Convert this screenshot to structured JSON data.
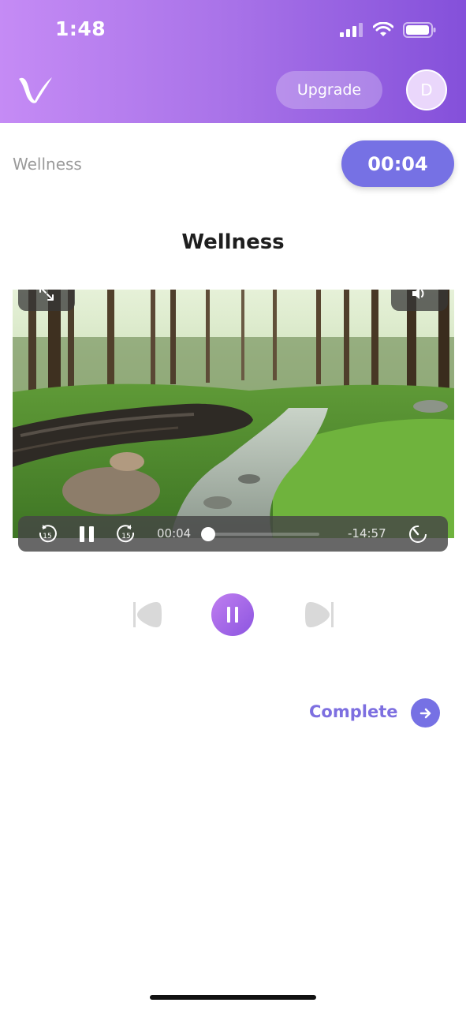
{
  "status_bar": {
    "time": "1:48"
  },
  "header": {
    "upgrade_label": "Upgrade",
    "avatar_initial": "D"
  },
  "breadcrumb": {
    "label": "Wellness"
  },
  "timer": {
    "value": "00:04"
  },
  "page": {
    "title": "Wellness"
  },
  "player": {
    "current_time": "00:04",
    "remaining_time": "-14:57",
    "skip_back_seconds": "15",
    "skip_forward_seconds": "15",
    "progress_fraction": 0.004
  },
  "complete": {
    "label": "Complete"
  },
  "colors": {
    "accent": "#7671e4",
    "header_start": "#c58bf5",
    "header_end": "#8450da"
  }
}
